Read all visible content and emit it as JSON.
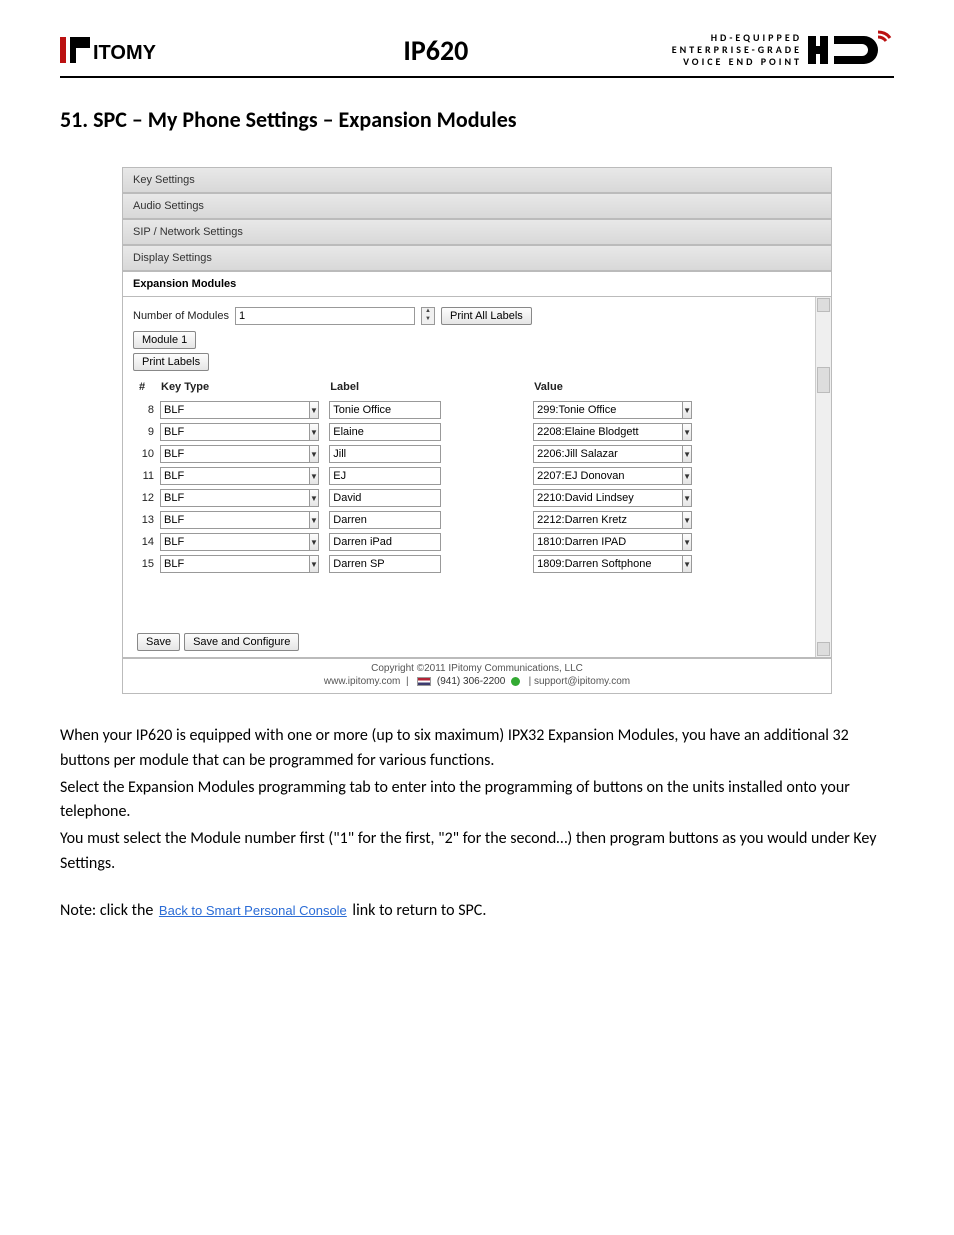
{
  "header": {
    "model": "IP620",
    "hd_tag_line1": "HD-EQUIPPED",
    "hd_tag_line2": "ENTERPRISE-GRADE",
    "hd_tag_line3": "VOICE END POINT"
  },
  "section_title": "51. SPC – My Phone Settings – Expansion Modules",
  "panel": {
    "tabs": {
      "key_settings": "Key Settings",
      "audio_settings": "Audio Settings",
      "sip_network": "SIP / Network Settings",
      "display_settings": "Display Settings",
      "expansion_modules": "Expansion Modules"
    },
    "num_modules_label": "Number of Modules",
    "num_modules_value": "1",
    "print_all_labels": "Print All Labels",
    "module_button": "Module 1",
    "print_labels": "Print Labels",
    "columns": {
      "num": "#",
      "type": "Key Type",
      "label": "Label",
      "value": "Value"
    },
    "rows": [
      {
        "n": "8",
        "type": "BLF",
        "label": "Tonie Office",
        "value": "299:Tonie Office"
      },
      {
        "n": "9",
        "type": "BLF",
        "label": "Elaine",
        "value": "2208:Elaine Blodgett"
      },
      {
        "n": "10",
        "type": "BLF",
        "label": "Jill",
        "value": "2206:Jill Salazar"
      },
      {
        "n": "11",
        "type": "BLF",
        "label": "EJ",
        "value": "2207:EJ Donovan"
      },
      {
        "n": "12",
        "type": "BLF",
        "label": "David",
        "value": "2210:David Lindsey"
      },
      {
        "n": "13",
        "type": "BLF",
        "label": "Darren",
        "value": "2212:Darren Kretz"
      },
      {
        "n": "14",
        "type": "BLF",
        "label": "Darren iPad",
        "value": "1810:Darren IPAD"
      },
      {
        "n": "15",
        "type": "BLF",
        "label": "Darren SP",
        "value": "1809:Darren Softphone"
      }
    ],
    "save": "Save",
    "save_configure": "Save and Configure",
    "footer_copyright": "Copyright ©2011 IPitomy Communications, LLC",
    "footer_site": "www.ipitomy.com",
    "footer_phone": "(941) 306-2200",
    "footer_email": "support@ipitomy.com"
  },
  "body": {
    "p1": "When your IP620 is equipped with one or more (up to six maximum) IPX32 Expansion Modules, you have an additional 32 buttons per module that can be programmed for various functions.",
    "p2": "Select the Expansion Modules programming tab to enter into the programming of buttons on the units installed onto your telephone.",
    "p3": "You must select the Module number first (\"1\" for the first, \"2\" for the second…) then program buttons as you would under Key Settings.",
    "note_prefix": "Note: click the ",
    "note_link": "Back to Smart Personal Console",
    "note_suffix": " link to return to SPC."
  }
}
